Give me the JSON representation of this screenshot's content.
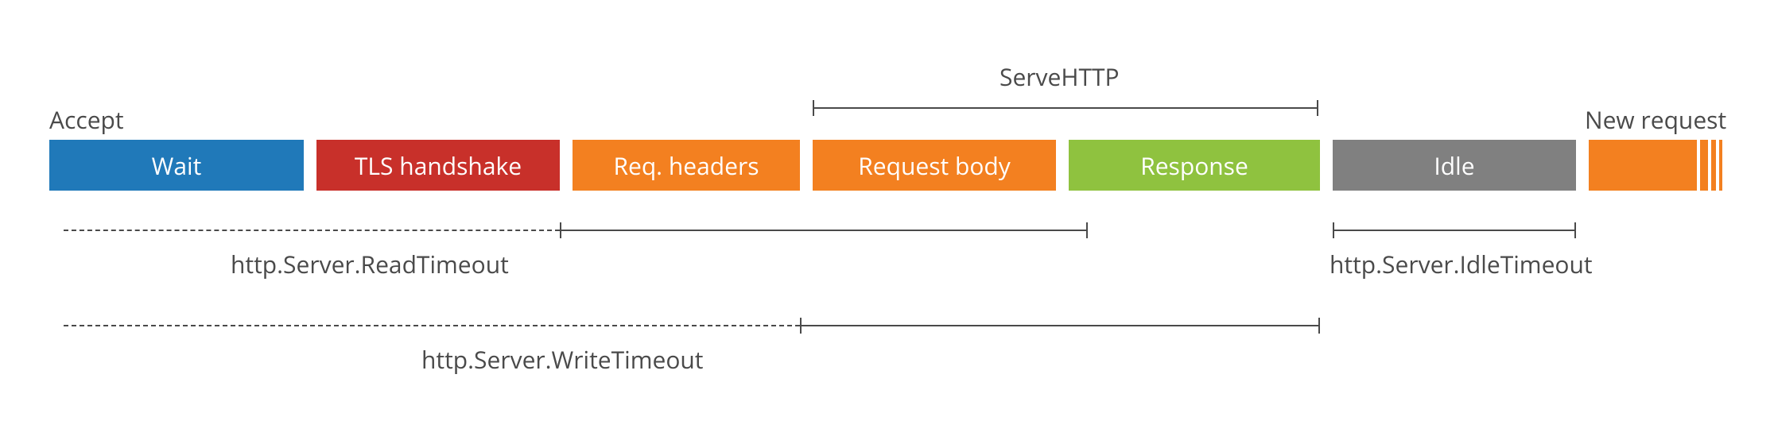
{
  "labels": {
    "accept": "Accept",
    "serveHTTP": "ServeHTTP",
    "newRequest": "New request"
  },
  "phases": {
    "wait": "Wait",
    "tls": "TLS handshake",
    "reqHeaders": "Req. headers",
    "reqBody": "Request body",
    "response": "Response",
    "idle": "Idle"
  },
  "timeouts": {
    "read": "http.Server.ReadTimeout",
    "write": "http.Server.WriteTimeout",
    "idle": "http.Server.IdleTimeout"
  },
  "colors": {
    "blue": "#2079b9",
    "red": "#c8302a",
    "orange": "#f38020",
    "green": "#8fc23f",
    "gray": "#808080",
    "text": "#4a4a4a"
  }
}
